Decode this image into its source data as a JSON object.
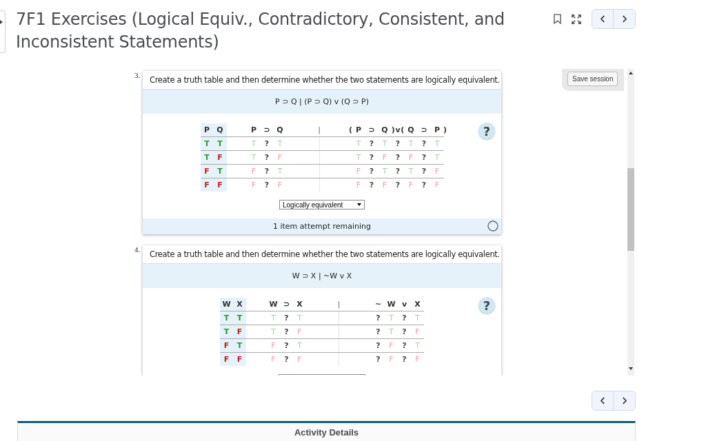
{
  "page": {
    "title": "7F1 Exercises (Logical Equiv., Contradictory, Consistent, and Inconsistent Statements)"
  },
  "questions": [
    {
      "number": "3.",
      "prompt": "Create a truth table and then determine whether the two statements are logically equivalent.",
      "formula": "P ⊃ Q | (P ⊃ Q) v (Q ⊃ P)",
      "help": "?",
      "given_header": [
        "P",
        "Q"
      ],
      "left_header": [
        {
          "text": "P"
        },
        {
          "text": "⊃"
        },
        {
          "text": "Q"
        }
      ],
      "separator": "|",
      "right_header": [
        {
          "text": "P",
          "open": "("
        },
        {
          "text": "⊃"
        },
        {
          "text": "Q",
          "close": ")"
        },
        {
          "text": "v"
        },
        {
          "text": "Q",
          "open": "("
        },
        {
          "text": "⊃"
        },
        {
          "text": "P",
          "close": ")"
        }
      ],
      "rows": [
        {
          "given": [
            {
              "text": "T",
              "kind": "true"
            },
            {
              "text": "T",
              "kind": "true"
            }
          ],
          "left": [
            {
              "text": "T",
              "kind": "true"
            },
            {
              "text": "?",
              "kind": "unknown"
            },
            {
              "text": "T",
              "kind": "true"
            }
          ],
          "right": [
            {
              "text": "T",
              "kind": "true"
            },
            {
              "text": "?",
              "kind": "unknown"
            },
            {
              "text": "T",
              "kind": "true"
            },
            {
              "text": "?",
              "kind": "unknown"
            },
            {
              "text": "T",
              "kind": "true"
            },
            {
              "text": "?",
              "kind": "unknown"
            },
            {
              "text": "T",
              "kind": "true"
            }
          ]
        },
        {
          "given": [
            {
              "text": "T",
              "kind": "true"
            },
            {
              "text": "F",
              "kind": "false"
            }
          ],
          "left": [
            {
              "text": "T",
              "kind": "true"
            },
            {
              "text": "?",
              "kind": "unknown"
            },
            {
              "text": "F",
              "kind": "false"
            }
          ],
          "right": [
            {
              "text": "T",
              "kind": "true"
            },
            {
              "text": "?",
              "kind": "unknown"
            },
            {
              "text": "F",
              "kind": "false"
            },
            {
              "text": "?",
              "kind": "unknown"
            },
            {
              "text": "F",
              "kind": "false"
            },
            {
              "text": "?",
              "kind": "unknown"
            },
            {
              "text": "T",
              "kind": "true"
            }
          ]
        },
        {
          "given": [
            {
              "text": "F",
              "kind": "false"
            },
            {
              "text": "T",
              "kind": "true"
            }
          ],
          "left": [
            {
              "text": "F",
              "kind": "false"
            },
            {
              "text": "?",
              "kind": "unknown"
            },
            {
              "text": "T",
              "kind": "true"
            }
          ],
          "right": [
            {
              "text": "F",
              "kind": "false"
            },
            {
              "text": "?",
              "kind": "unknown"
            },
            {
              "text": "T",
              "kind": "true"
            },
            {
              "text": "?",
              "kind": "unknown"
            },
            {
              "text": "T",
              "kind": "true"
            },
            {
              "text": "?",
              "kind": "unknown"
            },
            {
              "text": "F",
              "kind": "false"
            }
          ]
        },
        {
          "given": [
            {
              "text": "F",
              "kind": "false"
            },
            {
              "text": "F",
              "kind": "false"
            }
          ],
          "left": [
            {
              "text": "F",
              "kind": "false"
            },
            {
              "text": "?",
              "kind": "unknown"
            },
            {
              "text": "F",
              "kind": "false"
            }
          ],
          "right": [
            {
              "text": "F",
              "kind": "false"
            },
            {
              "text": "?",
              "kind": "unknown"
            },
            {
              "text": "F",
              "kind": "false"
            },
            {
              "text": "?",
              "kind": "unknown"
            },
            {
              "text": "F",
              "kind": "false"
            },
            {
              "text": "?",
              "kind": "unknown"
            },
            {
              "text": "F",
              "kind": "false"
            }
          ]
        }
      ],
      "answer": "Logically equivalent",
      "attempts": "1 item attempt remaining"
    },
    {
      "number": "4.",
      "prompt": "Create a truth table and then determine whether the two statements are logically equivalent.",
      "formula": "W ⊃ X | ~W v X",
      "help": "?",
      "given_header": [
        "W",
        "X"
      ],
      "left_header": [
        {
          "text": "W"
        },
        {
          "text": "⊃"
        },
        {
          "text": "X"
        }
      ],
      "separator": "|",
      "right_header": [
        {
          "text": "~"
        },
        {
          "text": "W"
        },
        {
          "text": "v"
        },
        {
          "text": "X"
        }
      ],
      "rows": [
        {
          "given": [
            {
              "text": "T",
              "kind": "true"
            },
            {
              "text": "T",
              "kind": "true"
            }
          ],
          "left": [
            {
              "text": "T",
              "kind": "true"
            },
            {
              "text": "?",
              "kind": "unknown"
            },
            {
              "text": "T",
              "kind": "true"
            }
          ],
          "right": [
            {
              "text": "?",
              "kind": "unknown"
            },
            {
              "text": "T",
              "kind": "true"
            },
            {
              "text": "?",
              "kind": "unknown"
            },
            {
              "text": "T",
              "kind": "true"
            }
          ]
        },
        {
          "given": [
            {
              "text": "T",
              "kind": "true"
            },
            {
              "text": "F",
              "kind": "false"
            }
          ],
          "left": [
            {
              "text": "T",
              "kind": "true"
            },
            {
              "text": "?",
              "kind": "unknown"
            },
            {
              "text": "F",
              "kind": "false"
            }
          ],
          "right": [
            {
              "text": "?",
              "kind": "unknown"
            },
            {
              "text": "T",
              "kind": "true"
            },
            {
              "text": "?",
              "kind": "unknown"
            },
            {
              "text": "F",
              "kind": "false"
            }
          ]
        },
        {
          "given": [
            {
              "text": "F",
              "kind": "false"
            },
            {
              "text": "T",
              "kind": "true"
            }
          ],
          "left": [
            {
              "text": "F",
              "kind": "false"
            },
            {
              "text": "?",
              "kind": "unknown"
            },
            {
              "text": "T",
              "kind": "true"
            }
          ],
          "right": [
            {
              "text": "?",
              "kind": "unknown"
            },
            {
              "text": "F",
              "kind": "false"
            },
            {
              "text": "?",
              "kind": "unknown"
            },
            {
              "text": "T",
              "kind": "true"
            }
          ]
        },
        {
          "given": [
            {
              "text": "F",
              "kind": "false"
            },
            {
              "text": "F",
              "kind": "false"
            }
          ],
          "left": [
            {
              "text": "F",
              "kind": "false"
            },
            {
              "text": "?",
              "kind": "unknown"
            },
            {
              "text": "F",
              "kind": "false"
            }
          ],
          "right": [
            {
              "text": "?",
              "kind": "unknown"
            },
            {
              "text": "F",
              "kind": "false"
            },
            {
              "text": "?",
              "kind": "unknown"
            },
            {
              "text": "F",
              "kind": "false"
            }
          ]
        }
      ]
    }
  ],
  "side_panel": {
    "button": "Save session"
  },
  "footer": {
    "panel_title": "Activity Details"
  }
}
